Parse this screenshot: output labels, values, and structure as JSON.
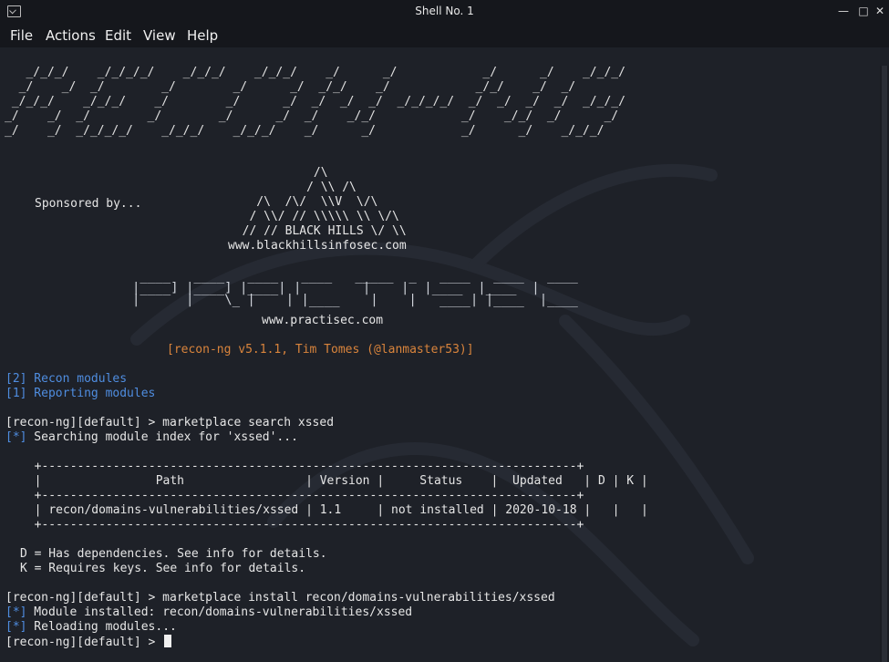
{
  "window": {
    "title": "Shell No. 1"
  },
  "menu": [
    "File",
    "Actions",
    "Edit",
    "View",
    "Help"
  ],
  "banner": [
    "   _/_/_/    _/_/_/_/    _/_/_/    _/_/_/    _/      _/            _/      _/    _/_/_/",
    "  _/    _/  _/        _/        _/      _/  _/_/    _/            _/_/    _/  _/",
    " _/_/_/    _/_/_/    _/        _/      _/  _/  _/  _/  _/_/_/_/  _/  _/  _/  _/  _/_/_/",
    "_/    _/  _/        _/        _/      _/  _/    _/_/            _/    _/_/  _/      _/",
    "_/    _/  _/_/_/_/    _/_/_/    _/_/_/    _/      _/            _/      _/    _/_/_/"
  ],
  "sponsor_label": "Sponsored by...",
  "bhis_art": [
    "            /\\",
    "           / \\\\ /\\",
    "    /\\  /\\/  \\\\V  \\/\\",
    "   / \\\\/ // \\\\\\\\\\ \\\\ \\/\\",
    "  // // BLACK HILLS \\/ \\\\"
  ],
  "bhis_url": "www.blackhillsinfosec.com",
  "practisec_art": [
    " ____   ____   ____   ____   _____  _   ____   ____   ____",
    "|____] |____] |____| |        |    |  |____  |____  |",
    "|      |    \\_ |    | |____    |    |   ____| |____  |____"
  ],
  "practisec_url": "www.practisec.com",
  "version_line": "[recon-ng v5.1.1, Tim Tomes (@lanmaster53)]",
  "module_counts": [
    "[2] Recon modules",
    "[1] Reporting modules"
  ],
  "cmd1": "[recon-ng][default] > marketplace search xssed",
  "searching": "[*] Searching module index for 'xssed'...",
  "table": {
    "headers": [
      "Path",
      "Version",
      "Status",
      "Updated",
      "D",
      "K"
    ],
    "rows": [
      [
        "recon/domains-vulnerabilities/xssed",
        "1.1",
        "not installed",
        "2020-10-18",
        "",
        ""
      ]
    ]
  },
  "legend": [
    "D = Has dependencies. See info for details.",
    "K = Requires keys. See info for details."
  ],
  "cmd2": "[recon-ng][default] > marketplace install recon/domains-vulnerabilities/xssed",
  "installed": "[*] Module installed: recon/domains-vulnerabilities/xssed",
  "reloading": "[*] Reloading modules...",
  "prompt": "[recon-ng][default] > ",
  "colors": {
    "accent_blue": "#4f8de0",
    "orange": "#d9843c",
    "bg": "#1e2128"
  }
}
